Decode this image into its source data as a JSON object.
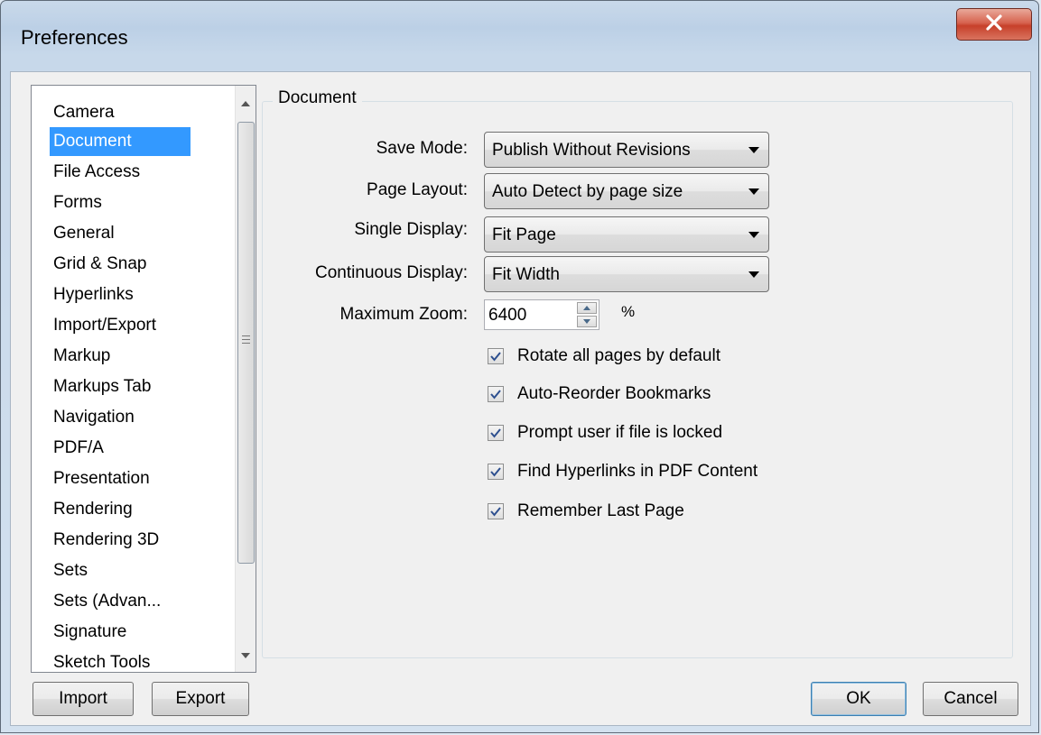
{
  "window": {
    "title": "Preferences"
  },
  "sidebar": {
    "items": [
      {
        "label": "Camera"
      },
      {
        "label": "Document",
        "selected": true
      },
      {
        "label": "File Access"
      },
      {
        "label": "Forms"
      },
      {
        "label": "General"
      },
      {
        "label": "Grid & Snap"
      },
      {
        "label": "Hyperlinks"
      },
      {
        "label": "Import/Export"
      },
      {
        "label": "Markup"
      },
      {
        "label": "Markups Tab"
      },
      {
        "label": "Navigation"
      },
      {
        "label": "PDF/A"
      },
      {
        "label": "Presentation"
      },
      {
        "label": "Rendering"
      },
      {
        "label": "Rendering 3D"
      },
      {
        "label": "Sets"
      },
      {
        "label": "Sets (Advan..."
      },
      {
        "label": "Signature"
      },
      {
        "label": "Sketch Tools"
      }
    ]
  },
  "group": {
    "title": "Document"
  },
  "fields": {
    "save_mode": {
      "label": "Save Mode:",
      "value": "Publish Without Revisions"
    },
    "page_layout": {
      "label": "Page Layout:",
      "value": "Auto Detect by page size"
    },
    "single_display": {
      "label": "Single Display:",
      "value": "Fit Page"
    },
    "continuous_display": {
      "label": "Continuous Display:",
      "value": "Fit Width"
    },
    "max_zoom": {
      "label": "Maximum Zoom:",
      "value": "6400",
      "unit": "%"
    }
  },
  "checkboxes": [
    {
      "label": "Rotate all pages by default",
      "checked": true
    },
    {
      "label": "Auto-Reorder Bookmarks",
      "checked": true
    },
    {
      "label": "Prompt user if file is locked",
      "checked": true
    },
    {
      "label": "Find Hyperlinks in PDF Content",
      "checked": true
    },
    {
      "label": "Remember Last Page",
      "checked": true
    }
  ],
  "buttons": {
    "import": "Import",
    "export": "Export",
    "ok": "OK",
    "cancel": "Cancel"
  },
  "colors": {
    "selection": "#3399ff",
    "close_button": "#c7402a"
  }
}
